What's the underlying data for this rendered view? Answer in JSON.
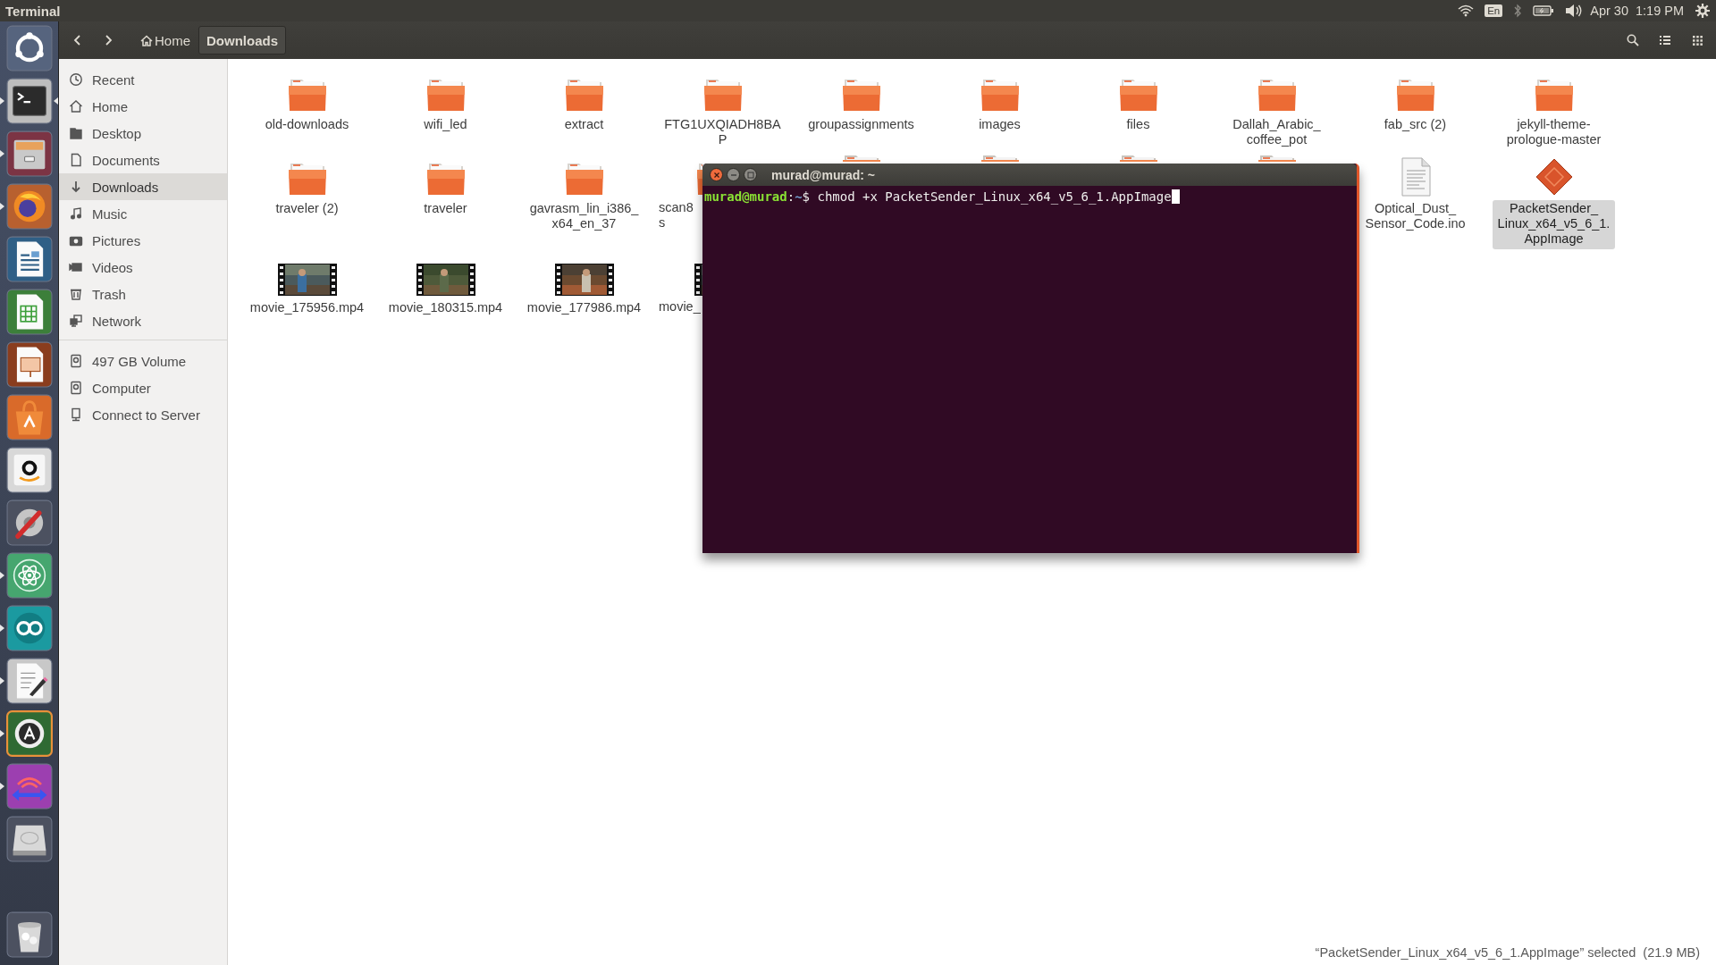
{
  "top_bar": {
    "app_title": "Terminal",
    "keyboard_layout": "En",
    "date": "Apr 30",
    "time": "1:19 PM"
  },
  "launcher": [
    {
      "kind": "ubuntu",
      "running": false,
      "focused": false
    },
    {
      "kind": "terminal",
      "running": true,
      "focused": true
    },
    {
      "kind": "files",
      "running": true,
      "focused": false
    },
    {
      "kind": "firefox",
      "running": true,
      "focused": false
    },
    {
      "kind": "writer",
      "running": false,
      "focused": false
    },
    {
      "kind": "calc",
      "running": false,
      "focused": false
    },
    {
      "kind": "impress",
      "running": false,
      "focused": false
    },
    {
      "kind": "software",
      "running": false,
      "focused": false
    },
    {
      "kind": "amazon",
      "running": false,
      "focused": false
    },
    {
      "kind": "settings",
      "running": false,
      "focused": false
    },
    {
      "kind": "atom",
      "running": true,
      "focused": false
    },
    {
      "kind": "arduino",
      "running": true,
      "focused": false
    },
    {
      "kind": "editor",
      "running": true,
      "focused": false
    },
    {
      "kind": "updater",
      "running": true,
      "focused": false
    },
    {
      "kind": "packetsender",
      "running": true,
      "focused": false
    },
    {
      "kind": "disk",
      "running": false,
      "focused": false
    },
    {
      "kind": "trash",
      "running": false,
      "focused": false
    }
  ],
  "toolbar": {
    "path": [
      {
        "kind": "home",
        "label": "Home",
        "selected": false
      },
      {
        "kind": "folder",
        "label": "Downloads",
        "selected": true
      }
    ]
  },
  "sidebar": {
    "places": [
      {
        "kind": "recent",
        "label": "Recent",
        "selected": false
      },
      {
        "kind": "home",
        "label": "Home",
        "selected": false
      },
      {
        "kind": "desktop",
        "label": "Desktop",
        "selected": false
      },
      {
        "kind": "documents",
        "label": "Documents",
        "selected": false
      },
      {
        "kind": "downloads",
        "label": "Downloads",
        "selected": true
      },
      {
        "kind": "music",
        "label": "Music",
        "selected": false
      },
      {
        "kind": "pictures",
        "label": "Pictures",
        "selected": false
      },
      {
        "kind": "videos",
        "label": "Videos",
        "selected": false
      },
      {
        "kind": "trash",
        "label": "Trash",
        "selected": false
      },
      {
        "kind": "network",
        "label": "Network",
        "selected": false
      }
    ],
    "devices": [
      {
        "kind": "drive",
        "label": "497 GB Volume",
        "selected": false
      },
      {
        "kind": "drive",
        "label": "Computer",
        "selected": false
      },
      {
        "kind": "server",
        "label": "Connect to Server",
        "selected": false
      }
    ]
  },
  "files": {
    "rows": [
      [
        {
          "kind": "folder",
          "label": [
            "old-downloads"
          ],
          "selected": false
        },
        {
          "kind": "folder",
          "label": [
            "wifi_led"
          ],
          "selected": false
        },
        {
          "kind": "folder",
          "label": [
            "extract"
          ],
          "selected": false
        },
        {
          "kind": "folder",
          "label": [
            "FTG1UXQIADH8BA",
            "P"
          ],
          "selected": false
        },
        {
          "kind": "folder",
          "label": [
            "groupassignments"
          ],
          "selected": false
        },
        {
          "kind": "folder",
          "label": [
            "images"
          ],
          "selected": false
        },
        {
          "kind": "folder",
          "label": [
            "files"
          ],
          "selected": false
        },
        {
          "kind": "folder",
          "label": [
            "Dallah_Arabic_",
            "coffee_pot"
          ],
          "selected": false
        },
        {
          "kind": "folder",
          "label": [
            "fab_src (2)"
          ],
          "selected": false
        },
        {
          "kind": "folder",
          "label": [
            "jekyll-theme-",
            "prologue-master"
          ],
          "selected": false
        }
      ],
      [
        {
          "kind": "folder",
          "label": [
            "traveler (2)"
          ],
          "selected": false,
          "partial": false
        },
        {
          "kind": "folder",
          "label": [
            "traveler"
          ],
          "selected": false
        },
        {
          "kind": "folder",
          "label": [
            "gavrasm_lin_i386_",
            "x64_en_37"
          ],
          "selected": false
        },
        {
          "kind": "folder",
          "label": [
            "scan8",
            "s"
          ],
          "selected": false,
          "partial": true
        },
        {
          "kind": "covered-folder"
        },
        {
          "kind": "covered-folder"
        },
        {
          "kind": "covered-folder"
        },
        {
          "kind": "covered-folder"
        },
        {
          "kind": "text",
          "label": [
            "Optical_Dust_",
            "Sensor_Code.ino"
          ],
          "selected": false
        },
        {
          "kind": "appimage",
          "label": [
            "PacketSender_",
            "Linux_x64_v5_6_1.",
            "AppImage"
          ],
          "selected": true
        }
      ],
      [
        {
          "kind": "video",
          "label": [
            "movie_175956.mp4"
          ],
          "selected": false
        },
        {
          "kind": "video",
          "label": [
            "movie_180315.mp4"
          ],
          "selected": false
        },
        {
          "kind": "video",
          "label": [
            "movie_177986.mp4"
          ],
          "selected": false
        },
        {
          "kind": "video",
          "label": [
            "movie_"
          ],
          "selected": false,
          "partial": true
        }
      ]
    ]
  },
  "terminal": {
    "title": "murad@murad: ~",
    "line": [
      {
        "kind": "user",
        "text": "murad@murad"
      },
      {
        "kind": "plain",
        "text": ":"
      },
      {
        "kind": "path",
        "text": "~"
      },
      {
        "kind": "plain",
        "text": "$ chmod +x PacketSender_Linux_x64_v5_6_1.AppImage"
      }
    ]
  },
  "status": {
    "text": "“PacketSender_Linux_x64_v5_6_1.AppImage” selected  (21.9 MB)"
  }
}
